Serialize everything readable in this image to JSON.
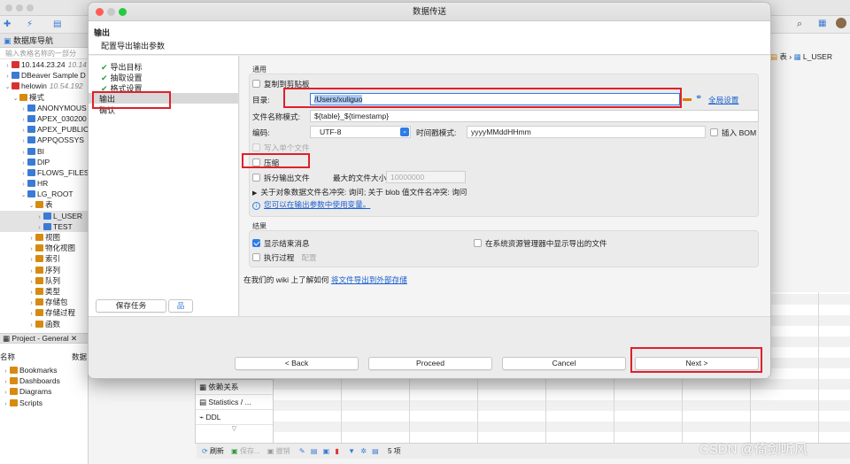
{
  "background": {
    "nav_tab": "数据库导航",
    "nav_tab2": "项",
    "filter_placeholder": "输入表格名称的一部分",
    "tree": [
      {
        "label": "10.144.23.24",
        "extra": "10.14",
        "level": 0,
        "icon": "db"
      },
      {
        "label": "DBeaver Sample D",
        "extra": "",
        "level": 0,
        "icon": "sample"
      },
      {
        "label": "helowin",
        "extra": "10.54.192",
        "level": 0,
        "icon": "db"
      },
      {
        "label": "模式",
        "extra": "",
        "level": 1,
        "icon": "folder"
      },
      {
        "label": "ANONYMOUS",
        "extra": "",
        "level": 2,
        "icon": "schema"
      },
      {
        "label": "APEX_030200",
        "extra": "",
        "level": 2,
        "icon": "schema"
      },
      {
        "label": "APEX_PUBLIC",
        "extra": "",
        "level": 2,
        "icon": "schema"
      },
      {
        "label": "APPQOSSYS",
        "extra": "",
        "level": 2,
        "icon": "schema"
      },
      {
        "label": "BI",
        "extra": "",
        "level": 2,
        "icon": "schema"
      },
      {
        "label": "DIP",
        "extra": "",
        "level": 2,
        "icon": "schema"
      },
      {
        "label": "FLOWS_FILES",
        "extra": "",
        "level": 2,
        "icon": "schema"
      },
      {
        "label": "HR",
        "extra": "",
        "level": 2,
        "icon": "schema"
      },
      {
        "label": "LG_ROOT",
        "extra": "",
        "level": 2,
        "icon": "schema"
      },
      {
        "label": "表",
        "extra": "",
        "level": 3,
        "icon": "folder"
      },
      {
        "label": "L_USER",
        "extra": "",
        "level": 4,
        "icon": "table",
        "selected": true
      },
      {
        "label": "TEST",
        "extra": "",
        "level": 4,
        "icon": "table",
        "selected": true
      },
      {
        "label": "视图",
        "extra": "",
        "level": 3,
        "icon": "folder"
      },
      {
        "label": "物化视图",
        "extra": "",
        "level": 3,
        "icon": "folder"
      },
      {
        "label": "索引",
        "extra": "",
        "level": 3,
        "icon": "folder"
      },
      {
        "label": "序列",
        "extra": "",
        "level": 3,
        "icon": "folder"
      },
      {
        "label": "队列",
        "extra": "",
        "level": 3,
        "icon": "folder"
      },
      {
        "label": "类型",
        "extra": "",
        "level": 3,
        "icon": "folder"
      },
      {
        "label": "存储包",
        "extra": "",
        "level": 3,
        "icon": "folder"
      },
      {
        "label": "存储过程",
        "extra": "",
        "level": 3,
        "icon": "folder"
      },
      {
        "label": "函数",
        "extra": "",
        "level": 3,
        "icon": "folder"
      }
    ],
    "project_tab": "Project - General",
    "project_cols": [
      "名称",
      "数据"
    ],
    "project_items": [
      "Bookmarks",
      "Dashboards",
      "Diagrams",
      "Scripts"
    ],
    "side_panel": [
      "依赖关系",
      "Statistics / ...",
      "DDL"
    ],
    "bottom_bar": {
      "refresh": "刷新",
      "save": "保存...",
      "cancel": "撤销",
      "count": "5 项"
    },
    "right_tree": {
      "table": "表",
      "item": "L_USER"
    },
    "watermark": "CSDN @倚剑听风"
  },
  "dialog": {
    "title": "数据传送",
    "header_title": "输出",
    "header_subtitle": "配置导出输出参数",
    "steps": [
      {
        "label": "导出目标",
        "done": true
      },
      {
        "label": "抽取设置",
        "done": true
      },
      {
        "label": "格式设置",
        "done": true
      },
      {
        "label": "输出",
        "done": false,
        "active": true
      },
      {
        "label": "确认",
        "done": false
      }
    ],
    "save_task_button": "保存任务",
    "general": {
      "section_label": "通用",
      "copy_to_clipboard": "复制到剪贴板",
      "directory_label": "目录:",
      "directory_value": "/Users/xuliguo",
      "global_settings_link": "全局设置",
      "filename_pattern_label": "文件名称模式:",
      "filename_pattern_value": "${table}_${timestamp}",
      "encoding_label": "编码:",
      "encoding_value": "UTF-8",
      "timestamp_label": "时间戳模式:",
      "timestamp_value": "yyyyMMddHHmm",
      "insert_bom": "插入 BOM",
      "write_single_file": "写入单个文件",
      "compress": "压缩",
      "split_output": "拆分输出文件",
      "max_file_size_label": "最大的文件大小:",
      "max_file_size_value": "10000000",
      "conflict_text": "关于对象数据文件名冲突: 询问; 关于 blob 值文件名冲突: 询问",
      "info_link": "您可以在输出参数中使用变量。"
    },
    "result": {
      "section_label": "结果",
      "show_end_message": "显示结束消息",
      "show_in_explorer": "在系统资源管理器中显示导出的文件",
      "execute_process": "执行过程",
      "configure": "配置"
    },
    "wiki_prefix": "在我们的 wiki 上了解如何",
    "wiki_link": "将文件导出到外部存储",
    "buttons": {
      "back": "< Back",
      "proceed": "Proceed",
      "cancel": "Cancel",
      "next": "Next >"
    }
  },
  "colors": {
    "accent": "#2f7ce6",
    "highlight_box": "#e0202a",
    "check": "#2e9c3f",
    "link": "#1a5fd1"
  }
}
